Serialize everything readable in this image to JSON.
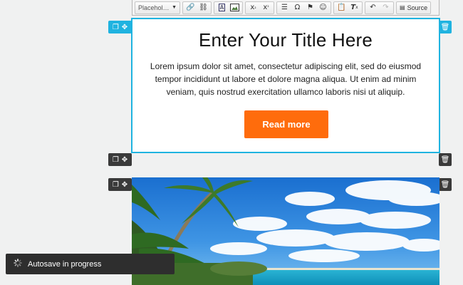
{
  "toolbar": {
    "format_combo": "Placehol…",
    "source_label": "Source",
    "icons": [
      "link-icon",
      "unlink-icon",
      "text-color-icon",
      "image-icon",
      "subscript-icon",
      "superscript-icon",
      "horizontal-rule-icon",
      "omega-icon",
      "flag-icon",
      "smiley-icon",
      "paste-icon",
      "remove-format-icon",
      "undo-icon",
      "redo-icon",
      "source-icon"
    ]
  },
  "block1": {
    "title": "Enter Your Title Here",
    "body": "Lorem ipsum dolor sit amet, consectetur adipiscing elit, sed do eiusmod tempor incididunt ut labore et dolore magna aliqua. Ut enim ad minim veniam, quis nostrud exercitation ullamco laboris nisi ut aliquip.",
    "button_label": "Read more"
  },
  "toast": {
    "text": "Autosave in progress"
  },
  "colors": {
    "accent": "#1fb3e0",
    "button": "#ff6c0c",
    "handle": "#3a3a3a"
  }
}
